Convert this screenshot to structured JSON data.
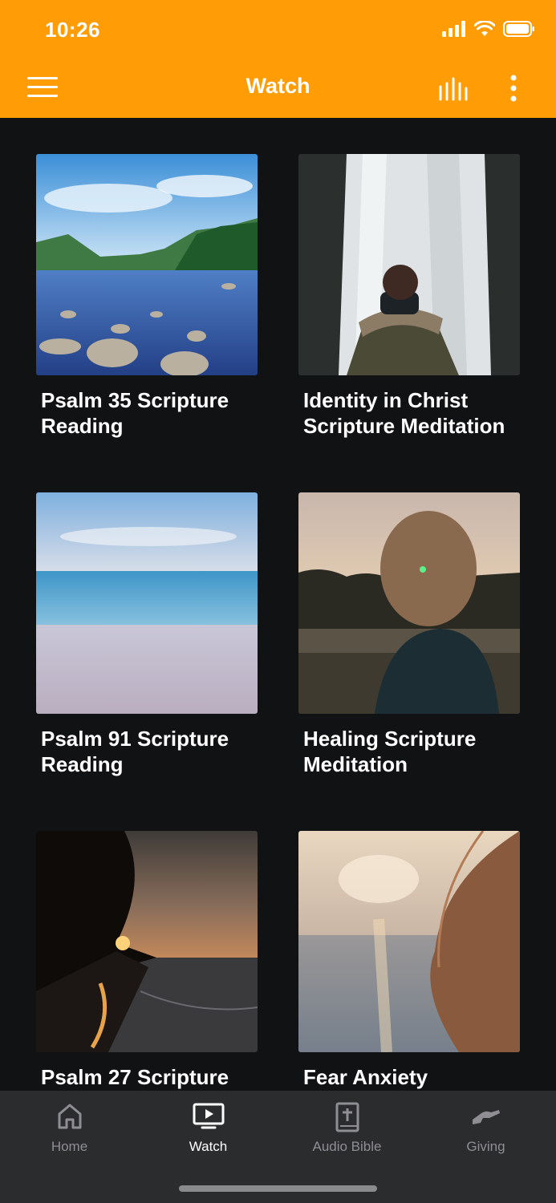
{
  "status": {
    "time": "10:26"
  },
  "header": {
    "title": "Watch"
  },
  "cards": [
    {
      "title": "Psalm 35 Scripture Reading"
    },
    {
      "title": "Identity in Christ Scripture Meditation"
    },
    {
      "title": "Psalm 91 Scripture Reading"
    },
    {
      "title": "Healing Scripture Meditation"
    },
    {
      "title": "Psalm 27 Scripture"
    },
    {
      "title": "Fear Anxiety"
    }
  ],
  "nav": {
    "items": [
      {
        "label": "Home",
        "icon": "home-icon"
      },
      {
        "label": "Watch",
        "icon": "tv-icon",
        "active": true
      },
      {
        "label": "Audio Bible",
        "icon": "bible-icon"
      },
      {
        "label": "Giving",
        "icon": "giving-hand-icon"
      }
    ]
  },
  "colors": {
    "accent": "#FF9C06",
    "background": "#111214",
    "nav_bg": "#2B2C2E",
    "inactive": "#8E8E93"
  }
}
